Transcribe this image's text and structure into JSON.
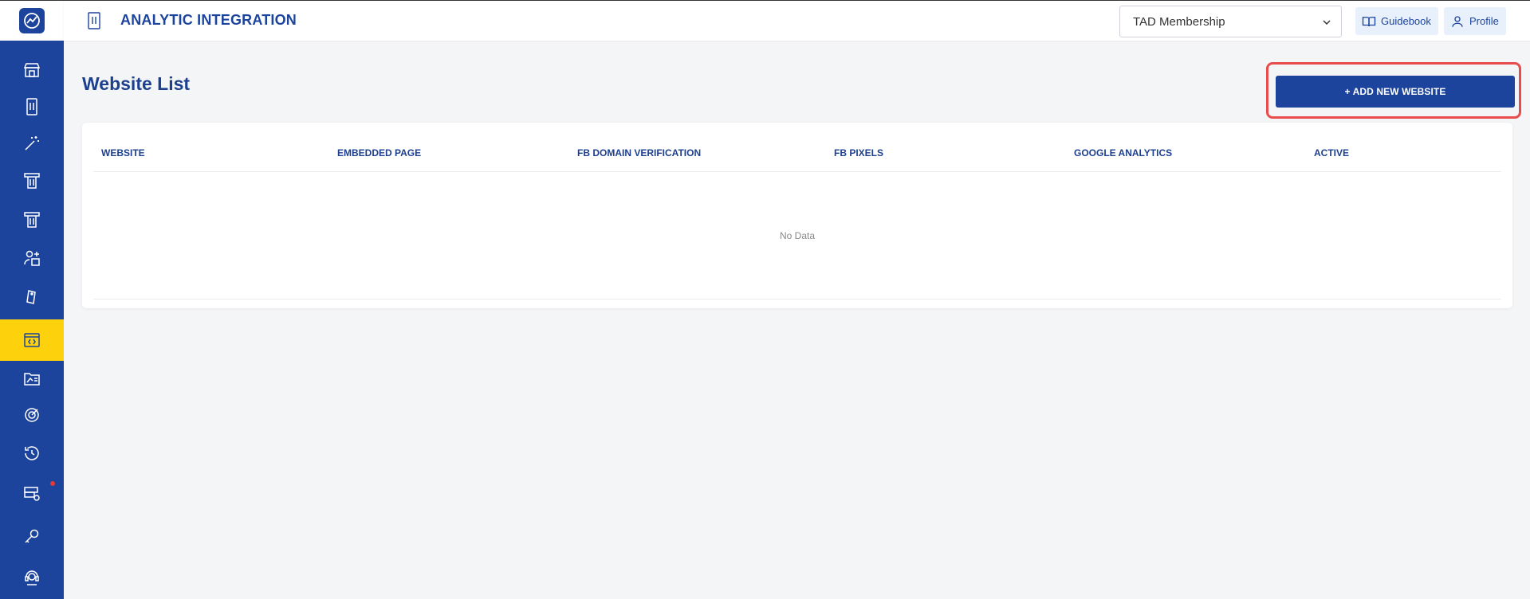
{
  "header": {
    "title": "ANALYTIC INTEGRATION",
    "membership_select": "TAD Membership",
    "guidebook_label": "Guidebook",
    "profile_label": "Profile"
  },
  "sidebar": {
    "active_item": "website-integration",
    "notification_dot_color": "#e53935",
    "accent_color": "#fdd20c",
    "brand_color": "#1c449c"
  },
  "main": {
    "page_title": "Website List",
    "add_button_label": "+ ADD NEW WEBSITE",
    "table": {
      "columns": [
        "WEBSITE",
        "EMBEDDED PAGE",
        "FB DOMAIN VERIFICATION",
        "FB PIXELS",
        "GOOGLE ANALYTICS",
        "ACTIVE"
      ],
      "empty_text": "No Data"
    }
  }
}
